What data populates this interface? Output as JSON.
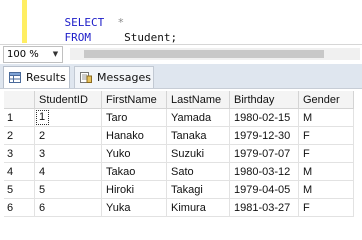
{
  "editor": {
    "line1_keyword": "SELECT",
    "line1_rest": "*",
    "line2_keyword": "FROM",
    "line2_rest": "Student;"
  },
  "zoom": {
    "value": "100 %"
  },
  "tabs": [
    {
      "label": "Results"
    },
    {
      "label": "Messages"
    }
  ],
  "results": {
    "columns": [
      "StudentID",
      "FirstName",
      "LastName",
      "Birthday",
      "Gender"
    ],
    "rows": [
      {
        "num": "1",
        "cells": [
          "1",
          "Taro",
          "Yamada",
          "1980-02-15",
          "M"
        ]
      },
      {
        "num": "2",
        "cells": [
          "2",
          "Hanako",
          "Tanaka",
          "1979-12-30",
          "F"
        ]
      },
      {
        "num": "3",
        "cells": [
          "3",
          "Yuko",
          "Suzuki",
          "1979-07-07",
          "F"
        ]
      },
      {
        "num": "4",
        "cells": [
          "4",
          "Takao",
          "Sato",
          "1980-03-12",
          "M"
        ]
      },
      {
        "num": "5",
        "cells": [
          "5",
          "Hiroki",
          "Takagi",
          "1979-04-05",
          "M"
        ]
      },
      {
        "num": "6",
        "cells": [
          "6",
          "Yuka",
          "Kimura",
          "1981-03-27",
          "F"
        ]
      }
    ]
  }
}
